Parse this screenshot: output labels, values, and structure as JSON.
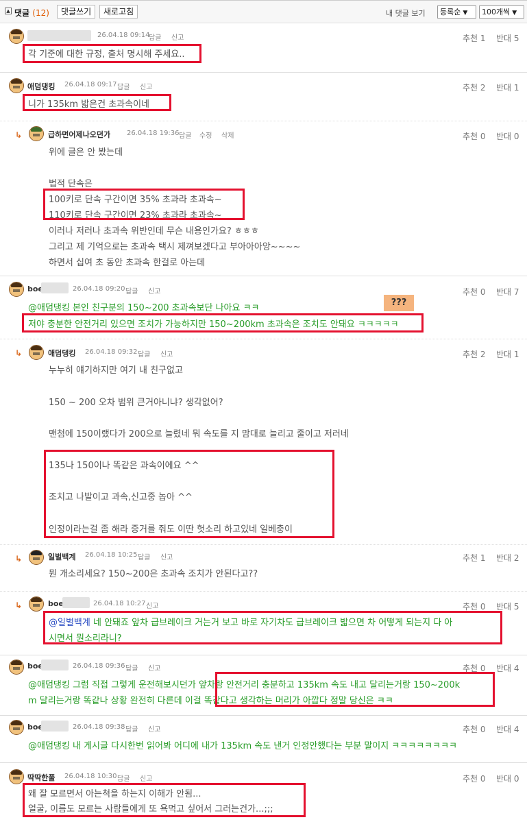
{
  "topbar": {
    "collapse_icon": "collapse-icon",
    "comments_label": "댓글",
    "comments_count": "(12)",
    "write_btn": "댓글쓰기",
    "refresh_btn": "새로고침",
    "my_comments": "내 댓글 보기",
    "sort_select": "등록순",
    "per_page_select": "100개씩"
  },
  "comments": [
    {
      "nick": "",
      "date": "26.04.18 09:14",
      "reply": "답글",
      "report": "신고",
      "up": "추천 1",
      "down": "반대 5",
      "lines": [
        "각 기준에 대한 규정, 출처 명시해 주세요.."
      ]
    },
    {
      "nick": "애덤댕킹",
      "date": "26.04.18 09:17",
      "reply": "답글",
      "report": "신고",
      "up": "추천 2",
      "down": "반대 1",
      "lines": [
        "니가 135km 밟은건 초과속이네"
      ]
    },
    {
      "nick": "급하면어제나오던가",
      "date": "26.04.18 19:36",
      "reply": "답글",
      "edit": "수정",
      "delete": "삭제",
      "up": "추천 0",
      "down": "반대 0",
      "lines": [
        "위에 글은 안 봤는데",
        "법적 단속은",
        "100키로 단속 구간이면 35% 초과라 초과속~",
        "110키로 단속 구간이면 23% 초과라 초과속~",
        "이러나 저러나 초과속 위반인데 무슨 내용인가요? ㅎㅎㅎ",
        "그리고 제 기억으로는 초과속 택시 제껴보겠다고 부아아아앙~~~~",
        "하면서 십여 초 동안 초과속 한걸로 아는데"
      ]
    },
    {
      "nick": "boe",
      "date": "26.04.18 09:20",
      "reply": "답글",
      "report": "신고",
      "up": "추천 0",
      "down": "반대 7",
      "lines": [
        "@애덤댕킹 본인 친구분의 150~200 초과속보단 나아요 ㅋㅋ",
        "저야 충분한 안전거리 있으면 조치가 가능하지만 150~200km 초과속은 조치도 안돼요 ㅋㅋㅋㅋㅋ"
      ],
      "annotation": "???"
    },
    {
      "nick": "애덤댕킹",
      "date": "26.04.18 09:32",
      "reply": "답글",
      "report": "신고",
      "up": "추천 2",
      "down": "반대 1",
      "lines": [
        "누누히 얘기하지만 여기 내 친구없고",
        "150 ~ 200 오차 범위 큰거아니냐? 생각없어?",
        "맨첨에 150이랬다가 200으로 늘렸네 뭐 속도를 지 맘대로 늘리고 줄이고 저러네",
        "135나 150이나 똑같은 과속이에요 ^^",
        "조치고 나발이고 과속,신고중 놉아 ^^",
        "인정이라는걸 좀 해라 증거를 줘도 이딴 헛소리 하고있네 일베충이"
      ]
    },
    {
      "nick": "일벌백계",
      "date": "26.04.18 10:25",
      "reply": "답글",
      "report": "신고",
      "up": "추천 1",
      "down": "반대 2",
      "lines": [
        "뭔 개소리세요? 150~200은 초과속 조치가 안된다고??"
      ]
    },
    {
      "nick": "boe",
      "date": "26.04.18 10:27",
      "report": "신고",
      "up": "추천 0",
      "down": "반대 5",
      "mention": "@일벌백계",
      "lines": [
        " 네 안돼죠 앞차 급브레이크 거는거 보고 바로 자기차도 급브레이크 밟으면 차 어떻게 되는지 다 아",
        "시면서 뭔소리라니?"
      ]
    },
    {
      "nick": "boe",
      "date": "26.04.18 09:36",
      "reply": "답글",
      "report": "신고",
      "up": "추천 0",
      "down": "반대 4",
      "lines": [
        "@애덤댕킹 그럼 직접 그렇게 운전해보시던가 앞차랑 안전거리 충분하고 135km 속도 내고 달리는거랑 150~200k",
        "m 달리는거랑 똑같나 상황 완전히 다른데 이걸 똑같다고 생각하는 머리가 아깝다 정말 당신은 ㅋㅋ"
      ]
    },
    {
      "nick": "boe",
      "date": "26.04.18 09:38",
      "reply": "답글",
      "report": "신고",
      "up": "추천 0",
      "down": "반대 4",
      "lines": [
        "@애덤댕킹 내 게시글 다시한번 읽어봐 어디에 내가 135km 속도 낸거 인정안했다는 부분 말이지 ㅋㅋㅋㅋㅋㅋㅋㅋ"
      ]
    },
    {
      "nick": "딱딱한풀",
      "date": "26.04.18 10:30",
      "reply": "답글",
      "report": "신고",
      "up": "추천 0",
      "down": "반대 0",
      "lines": [
        "왜 잘 모르면서 아는척을 하는지 이해가 안됨...",
        "얼굴, 이름도 모르는 사람들에게 또 욕먹고 싶어서 그러는건가...;;;"
      ]
    }
  ]
}
